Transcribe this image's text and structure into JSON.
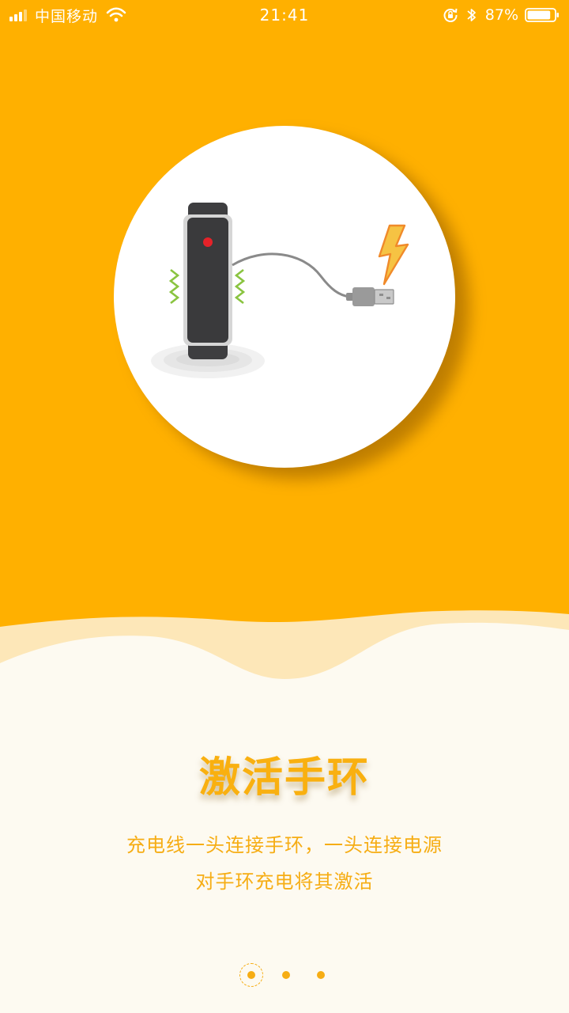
{
  "status_bar": {
    "carrier": "中国移动",
    "time": "21:41",
    "battery_percent": "87%",
    "battery_level": 0.87,
    "icons": [
      "signal-icon",
      "wifi-icon",
      "rotation-lock-icon",
      "bluetooth-icon",
      "battery-icon"
    ]
  },
  "colors": {
    "background_top": "#ffb000",
    "background_bottom": "#fdfaf1",
    "accent_text": "#f6ad14",
    "wave_light": "#fde7b8"
  },
  "illustration": {
    "icons": [
      "fitness-band-icon",
      "usb-cable-icon",
      "lightning-icon",
      "vibration-icon"
    ]
  },
  "content": {
    "title": "激活手环",
    "description_line1": "充电线一头连接手环，一头连接电源",
    "description_line2": "对手环充电将其激活"
  },
  "pager": {
    "total_pages": 3,
    "current_page": 1
  }
}
